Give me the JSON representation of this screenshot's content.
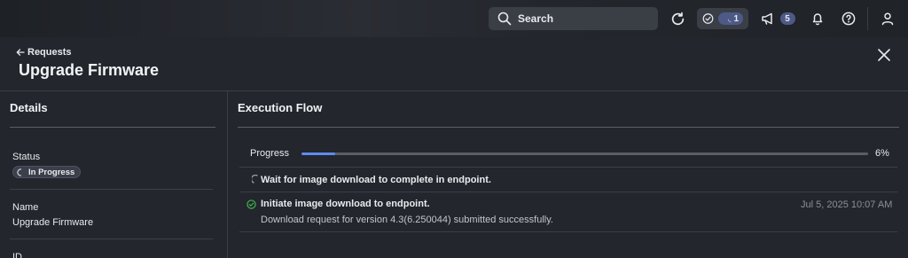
{
  "topbar": {
    "search_label": "Search",
    "tasks_count": "1",
    "announcements_count": "5"
  },
  "header": {
    "back_label": "Requests",
    "title": "Upgrade Firmware"
  },
  "details": {
    "heading": "Details",
    "fields": [
      {
        "label": "Status",
        "value": "In Progress"
      },
      {
        "label": "Name",
        "value": "Upgrade Firmware"
      },
      {
        "label": "ID",
        "value": ""
      }
    ]
  },
  "execution": {
    "heading": "Execution Flow",
    "progress_label": "Progress",
    "progress_value": 0.06,
    "progress_text": "6%",
    "steps": [
      {
        "title": "Wait for image download to complete in endpoint.",
        "status": "in-progress",
        "subtitle": "",
        "time": ""
      },
      {
        "title": "Initiate image download to endpoint.",
        "status": "success",
        "subtitle": "Download request for version 4.3(6.250044) submitted successfully.",
        "time": "Jul 5, 2025 10:07 AM"
      }
    ]
  },
  "colors": {
    "accent": "#5b8def",
    "badge": "#4d5a88",
    "success": "#3fb950"
  }
}
